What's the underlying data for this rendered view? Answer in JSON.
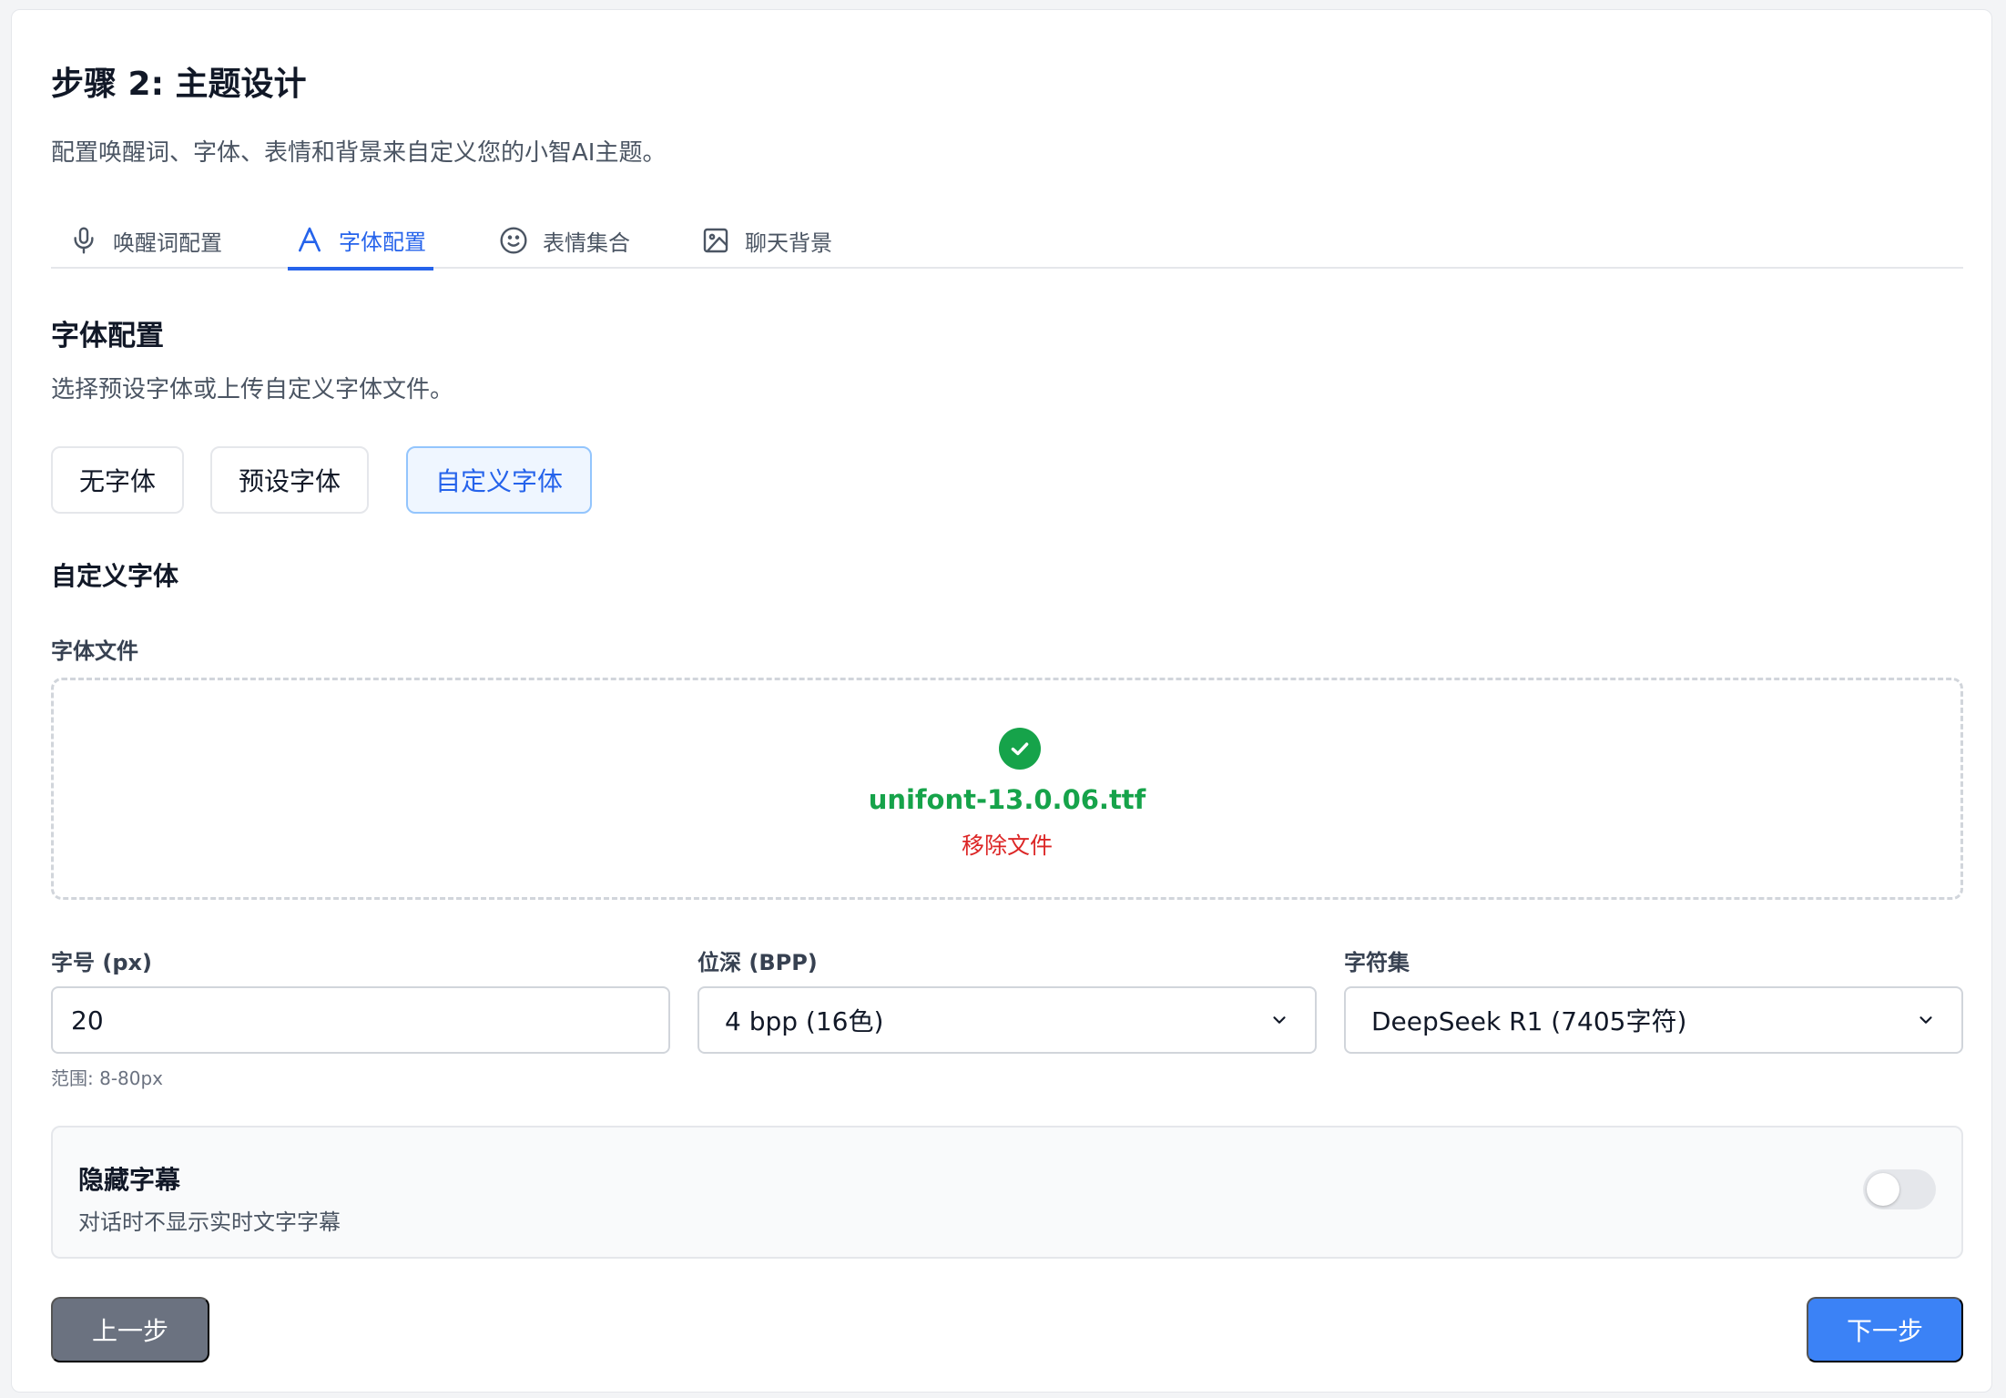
{
  "page": {
    "step_title": "步骤 2: 主题设计",
    "step_desc": "配置唤醒词、字体、表情和背景来自定义您的小智AI主题。"
  },
  "tabs": [
    {
      "label": "唤醒词配置",
      "icon": "microphone-icon"
    },
    {
      "label": "字体配置",
      "icon": "font-icon",
      "active": true
    },
    {
      "label": "表情集合",
      "icon": "smiley-icon"
    },
    {
      "label": "聊天背景",
      "icon": "image-icon"
    }
  ],
  "font_section": {
    "title": "字体配置",
    "desc": "选择预设字体或上传自定义字体文件。",
    "options": [
      "无字体",
      "预设字体",
      "自定义字体"
    ],
    "selected_option": "自定义字体"
  },
  "custom_font": {
    "title": "自定义字体",
    "file_label": "字体文件",
    "file_name": "unifont-13.0.06.ttf",
    "remove_label": "移除文件"
  },
  "settings": {
    "size_label": "字号 (px)",
    "size_value": "20",
    "size_hint": "范围: 8-80px",
    "bpp_label": "位深 (BPP)",
    "bpp_value": "4 bpp (16色)",
    "charset_label": "字符集",
    "charset_value": "DeepSeek R1 (7405字符)"
  },
  "subtitle_toggle": {
    "title": "隐藏字幕",
    "desc": "对话时不显示实时文字字幕",
    "enabled": false
  },
  "nav": {
    "prev_label": "上一步",
    "next_label": "下一步"
  },
  "colors": {
    "accent": "#2563eb",
    "success": "#16a34a",
    "danger": "#dc2626",
    "prev_button": "#6b7280",
    "next_button": "#3b82f6"
  }
}
